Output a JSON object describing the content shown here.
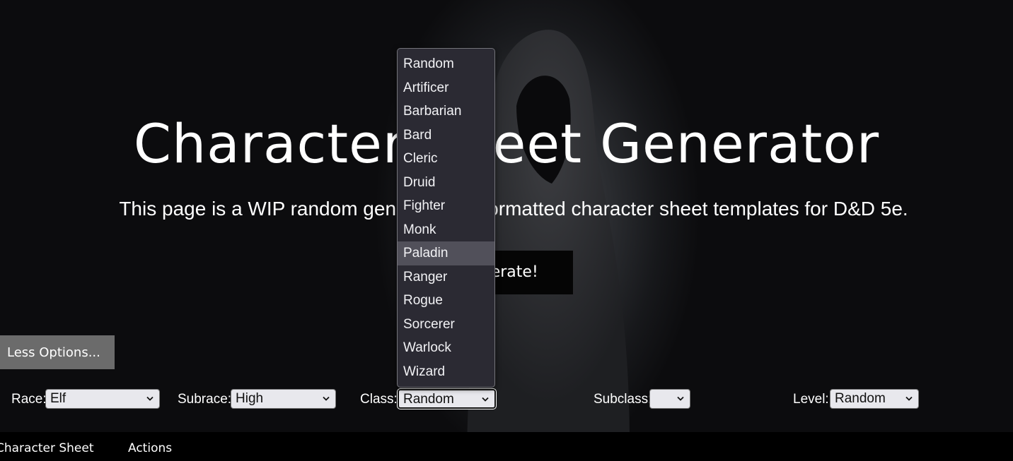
{
  "header": {
    "title": "Character Sheet Generator",
    "subtitle": "This page is a WIP random generator for formatted character sheet templates for D&D 5e."
  },
  "actions": {
    "generate_label": "Generate!",
    "less_options_label": "Less Options..."
  },
  "options": {
    "race": {
      "label": "Race:",
      "value": "Elf"
    },
    "subrace": {
      "label": "Subrace:",
      "value": "High"
    },
    "class": {
      "label": "Class:",
      "value": "Random"
    },
    "subclass": {
      "label": "Subclass:",
      "value": ""
    },
    "level": {
      "label": "Level:",
      "value": "Random"
    }
  },
  "class_dropdown": {
    "open": true,
    "highlighted": "Paladin",
    "items": [
      "Random",
      "Artificer",
      "Barbarian",
      "Bard",
      "Cleric",
      "Druid",
      "Fighter",
      "Monk",
      "Paladin",
      "Ranger",
      "Rogue",
      "Sorcerer",
      "Warlock",
      "Wizard"
    ]
  },
  "tabs": [
    {
      "label": "Character Sheet"
    },
    {
      "label": "Actions"
    }
  ],
  "colors": {
    "background": "#0c0c0e",
    "dropdown_bg": "#2b2a33",
    "dropdown_highlight": "#51505a",
    "button_gray": "#6b6b6b",
    "select_bg": "#e8e8ed"
  }
}
